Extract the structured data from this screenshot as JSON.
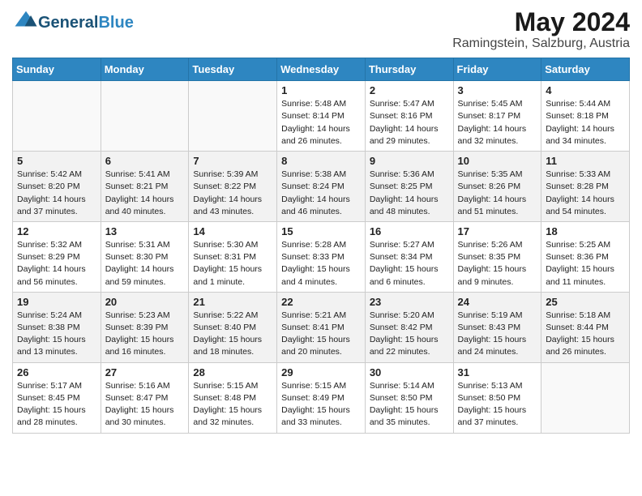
{
  "logo": {
    "text_general": "General",
    "text_blue": "Blue"
  },
  "title": {
    "month_year": "May 2024",
    "location": "Ramingstein, Salzburg, Austria"
  },
  "weekdays": [
    "Sunday",
    "Monday",
    "Tuesday",
    "Wednesday",
    "Thursday",
    "Friday",
    "Saturday"
  ],
  "weeks": [
    [
      {
        "day": "",
        "content": ""
      },
      {
        "day": "",
        "content": ""
      },
      {
        "day": "",
        "content": ""
      },
      {
        "day": "1",
        "content": "Sunrise: 5:48 AM\nSunset: 8:14 PM\nDaylight: 14 hours\nand 26 minutes."
      },
      {
        "day": "2",
        "content": "Sunrise: 5:47 AM\nSunset: 8:16 PM\nDaylight: 14 hours\nand 29 minutes."
      },
      {
        "day": "3",
        "content": "Sunrise: 5:45 AM\nSunset: 8:17 PM\nDaylight: 14 hours\nand 32 minutes."
      },
      {
        "day": "4",
        "content": "Sunrise: 5:44 AM\nSunset: 8:18 PM\nDaylight: 14 hours\nand 34 minutes."
      }
    ],
    [
      {
        "day": "5",
        "content": "Sunrise: 5:42 AM\nSunset: 8:20 PM\nDaylight: 14 hours\nand 37 minutes."
      },
      {
        "day": "6",
        "content": "Sunrise: 5:41 AM\nSunset: 8:21 PM\nDaylight: 14 hours\nand 40 minutes."
      },
      {
        "day": "7",
        "content": "Sunrise: 5:39 AM\nSunset: 8:22 PM\nDaylight: 14 hours\nand 43 minutes."
      },
      {
        "day": "8",
        "content": "Sunrise: 5:38 AM\nSunset: 8:24 PM\nDaylight: 14 hours\nand 46 minutes."
      },
      {
        "day": "9",
        "content": "Sunrise: 5:36 AM\nSunset: 8:25 PM\nDaylight: 14 hours\nand 48 minutes."
      },
      {
        "day": "10",
        "content": "Sunrise: 5:35 AM\nSunset: 8:26 PM\nDaylight: 14 hours\nand 51 minutes."
      },
      {
        "day": "11",
        "content": "Sunrise: 5:33 AM\nSunset: 8:28 PM\nDaylight: 14 hours\nand 54 minutes."
      }
    ],
    [
      {
        "day": "12",
        "content": "Sunrise: 5:32 AM\nSunset: 8:29 PM\nDaylight: 14 hours\nand 56 minutes."
      },
      {
        "day": "13",
        "content": "Sunrise: 5:31 AM\nSunset: 8:30 PM\nDaylight: 14 hours\nand 59 minutes."
      },
      {
        "day": "14",
        "content": "Sunrise: 5:30 AM\nSunset: 8:31 PM\nDaylight: 15 hours\nand 1 minute."
      },
      {
        "day": "15",
        "content": "Sunrise: 5:28 AM\nSunset: 8:33 PM\nDaylight: 15 hours\nand 4 minutes."
      },
      {
        "day": "16",
        "content": "Sunrise: 5:27 AM\nSunset: 8:34 PM\nDaylight: 15 hours\nand 6 minutes."
      },
      {
        "day": "17",
        "content": "Sunrise: 5:26 AM\nSunset: 8:35 PM\nDaylight: 15 hours\nand 9 minutes."
      },
      {
        "day": "18",
        "content": "Sunrise: 5:25 AM\nSunset: 8:36 PM\nDaylight: 15 hours\nand 11 minutes."
      }
    ],
    [
      {
        "day": "19",
        "content": "Sunrise: 5:24 AM\nSunset: 8:38 PM\nDaylight: 15 hours\nand 13 minutes."
      },
      {
        "day": "20",
        "content": "Sunrise: 5:23 AM\nSunset: 8:39 PM\nDaylight: 15 hours\nand 16 minutes."
      },
      {
        "day": "21",
        "content": "Sunrise: 5:22 AM\nSunset: 8:40 PM\nDaylight: 15 hours\nand 18 minutes."
      },
      {
        "day": "22",
        "content": "Sunrise: 5:21 AM\nSunset: 8:41 PM\nDaylight: 15 hours\nand 20 minutes."
      },
      {
        "day": "23",
        "content": "Sunrise: 5:20 AM\nSunset: 8:42 PM\nDaylight: 15 hours\nand 22 minutes."
      },
      {
        "day": "24",
        "content": "Sunrise: 5:19 AM\nSunset: 8:43 PM\nDaylight: 15 hours\nand 24 minutes."
      },
      {
        "day": "25",
        "content": "Sunrise: 5:18 AM\nSunset: 8:44 PM\nDaylight: 15 hours\nand 26 minutes."
      }
    ],
    [
      {
        "day": "26",
        "content": "Sunrise: 5:17 AM\nSunset: 8:45 PM\nDaylight: 15 hours\nand 28 minutes."
      },
      {
        "day": "27",
        "content": "Sunrise: 5:16 AM\nSunset: 8:47 PM\nDaylight: 15 hours\nand 30 minutes."
      },
      {
        "day": "28",
        "content": "Sunrise: 5:15 AM\nSunset: 8:48 PM\nDaylight: 15 hours\nand 32 minutes."
      },
      {
        "day": "29",
        "content": "Sunrise: 5:15 AM\nSunset: 8:49 PM\nDaylight: 15 hours\nand 33 minutes."
      },
      {
        "day": "30",
        "content": "Sunrise: 5:14 AM\nSunset: 8:50 PM\nDaylight: 15 hours\nand 35 minutes."
      },
      {
        "day": "31",
        "content": "Sunrise: 5:13 AM\nSunset: 8:50 PM\nDaylight: 15 hours\nand 37 minutes."
      },
      {
        "day": "",
        "content": ""
      }
    ]
  ]
}
